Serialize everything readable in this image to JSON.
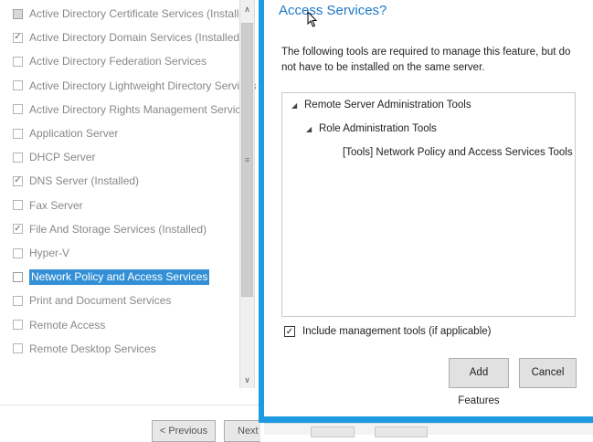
{
  "roles": [
    {
      "label": "Active Directory Certificate Services (Installed)",
      "state": "partial"
    },
    {
      "label": "Active Directory Domain Services (Installed)",
      "state": "checked"
    },
    {
      "label": "Active Directory Federation Services",
      "state": "unchecked"
    },
    {
      "label": "Active Directory Lightweight Directory Services",
      "state": "unchecked"
    },
    {
      "label": "Active Directory Rights Management Services",
      "state": "unchecked"
    },
    {
      "label": "Application Server",
      "state": "unchecked"
    },
    {
      "label": "DHCP Server",
      "state": "unchecked"
    },
    {
      "label": "DNS Server (Installed)",
      "state": "checked"
    },
    {
      "label": "Fax Server",
      "state": "unchecked"
    },
    {
      "label": "File And Storage Services (Installed)",
      "state": "checked"
    },
    {
      "label": "Hyper-V",
      "state": "unchecked"
    },
    {
      "label": "Network Policy and Access Services",
      "state": "unchecked",
      "selected": true
    },
    {
      "label": "Print and Document Services",
      "state": "unchecked"
    },
    {
      "label": "Remote Access",
      "state": "unchecked"
    },
    {
      "label": "Remote Desktop Services",
      "state": "unchecked"
    }
  ],
  "wizard": {
    "prev_label": "< Previous",
    "next_label": "Next"
  },
  "dialog": {
    "title": "Access Services?",
    "description": "The following tools are required to manage this feature, but do not have to be installed on the same server.",
    "tree": [
      {
        "label": "Remote Server Administration Tools",
        "level": 0,
        "expanded": true
      },
      {
        "label": "Role Administration Tools",
        "level": 1,
        "expanded": true
      },
      {
        "label": "[Tools] Network Policy and Access Services Tools",
        "level": 2,
        "expanded": false
      }
    ],
    "include_tools_label": "Include management tools (if applicable)",
    "include_tools_checked": true,
    "add_features_label": "Add Features",
    "cancel_label": "Cancel"
  },
  "colors": {
    "accent": "#1e9be0",
    "selection": "#3390d6",
    "title": "#1e78c8"
  }
}
